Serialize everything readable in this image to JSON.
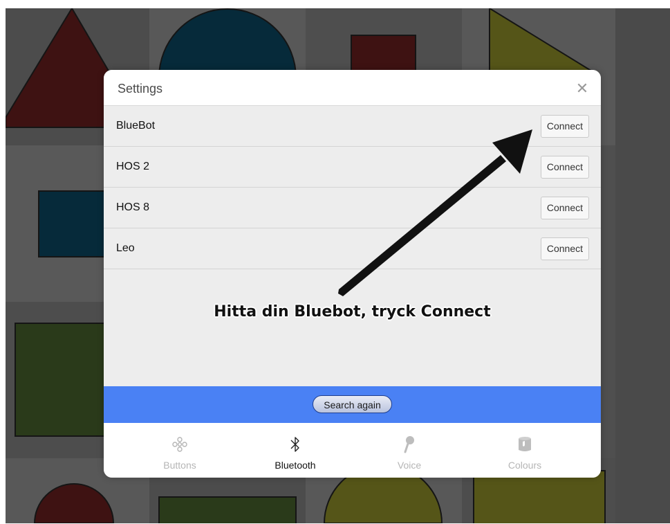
{
  "modal": {
    "title": "Settings",
    "close_icon": "close-icon",
    "devices": [
      {
        "name": "BlueBot",
        "action": "Connect"
      },
      {
        "name": "HOS 2",
        "action": "Connect"
      },
      {
        "name": "HOS 8",
        "action": "Connect"
      },
      {
        "name": "Leo",
        "action": "Connect"
      }
    ],
    "annotation": "Hitta din Bluebot, tryck Connect",
    "search_again": "Search again",
    "tabs": [
      {
        "label": "Buttons",
        "icon": "buttons-icon",
        "active": false
      },
      {
        "label": "Bluetooth",
        "icon": "bluetooth-icon",
        "active": true
      },
      {
        "label": "Voice",
        "icon": "microphone-icon",
        "active": false
      },
      {
        "label": "Colours",
        "icon": "paint-bucket-icon",
        "active": false
      }
    ]
  },
  "colors": {
    "accent_bar": "#4a81f4",
    "background": "#4f4f4f",
    "shape_red": "#3e1212",
    "shape_blue": "#062a3a",
    "shape_green": "#2a3a1a",
    "shape_yellow": "#555518"
  }
}
